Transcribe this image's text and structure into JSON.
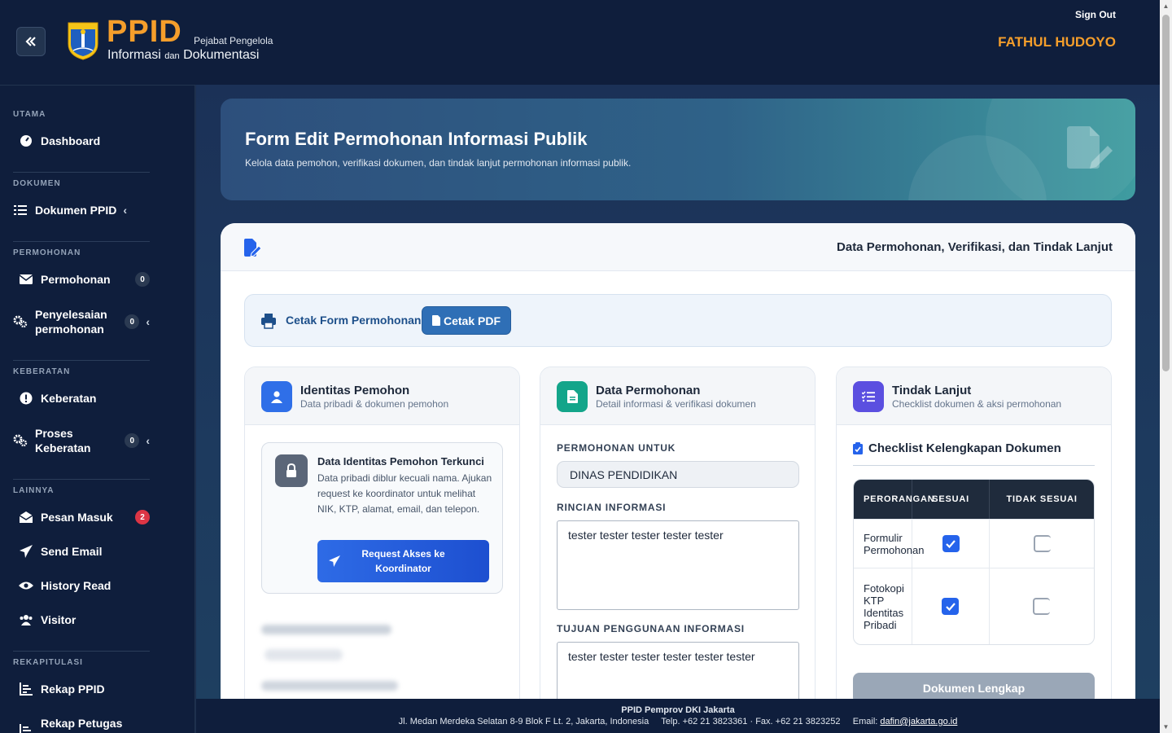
{
  "header": {
    "logo_main": "PPID",
    "logo_line1": "Pejabat Pengelola",
    "logo_line2a": "Informasi",
    "logo_line2b": "dan",
    "logo_line2c": "Dokumentasi",
    "signout": "Sign Out",
    "username": "FATHUL HUDOYO"
  },
  "sidebar": {
    "sections": {
      "utama": "UTAMA",
      "dokumen": "DOKUMEN",
      "permohonan": "PERMOHONAN",
      "keberatan": "KEBERATAN",
      "lainnya": "LAINNYA",
      "rekapitulasi": "REKAPITULASI"
    },
    "items": {
      "dashboard": "Dashboard",
      "dokumen_ppid": "Dokumen PPID",
      "permohonan": "Permohonan",
      "permohonan_count": "0",
      "penyelesaian_1": "Penyelesaian",
      "penyelesaian_2": "permohonan",
      "penyelesaian_count": "0",
      "keberatan": "Keberatan",
      "proses_1": "Proses",
      "proses_2": "Keberatan",
      "proses_count": "0",
      "pesan_masuk": "Pesan Masuk",
      "pesan_count": "2",
      "send_email": "Send Email",
      "history_read": "History Read",
      "visitor": "Visitor",
      "rekap_ppid": "Rekap PPID",
      "rekap_petugas": "Rekap Petugas Data"
    }
  },
  "hero": {
    "title": "Form Edit Permohonan Informasi Publik",
    "subtitle": "Kelola data pemohon, verifikasi dokumen, dan tindak lanjut permohonan informasi publik."
  },
  "card": {
    "title": "Data Permohonan, Verifikasi, dan Tindak Lanjut",
    "print_label": "Cetak Form Permohonan",
    "pdf_label": "Cetak PDF"
  },
  "identitas": {
    "title": "Identitas Pemohon",
    "subtitle": "Data pribadi & dokumen pemohon",
    "lock_title": "Data Identitas Pemohon Terkunci",
    "lock_desc": "Data pribadi diblur kecuali nama. Ajukan request ke koordinator untuk melihat NIK, KTP, alamat, email, dan telepon.",
    "request_button": "Request Akses ke Koordinator"
  },
  "data_permohonan": {
    "title": "Data Permohonan",
    "subtitle": "Detail informasi & verifikasi dokumen",
    "untuk_label": "PERMOHONAN UNTUK",
    "untuk_value": "DINAS PENDIDIKAN",
    "rincian_label": "RINCIAN INFORMASI",
    "rincian_value": "tester tester tester tester tester",
    "tujuan_label": "TUJUAN PENGGUNAAN INFORMASI",
    "tujuan_value": "tester tester tester tester tester tester"
  },
  "tindak_lanjut": {
    "title": "Tindak Lanjut",
    "subtitle": "Checklist dokumen & aksi permohonan",
    "checklist_title": "Checklist Kelengkapan Dokumen",
    "col_perorangan": "PERORANGAN",
    "col_sesuai": "SESUAI",
    "col_tidak": "TIDAK SESUAI",
    "rows": [
      {
        "label": "Formulir Permohonan",
        "sesuai": true,
        "tidak_sesuai": false
      },
      {
        "label": "Fotokopi KTP Identitas Pribadi",
        "sesuai": true,
        "tidak_sesuai": false
      }
    ],
    "lengkap_button": "Dokumen Lengkap"
  },
  "footer": {
    "org": "PPID Pemprov DKI Jakarta",
    "address": "Jl. Medan Merdeka Selatan 8-9 Blok F Lt. 2, Jakarta, Indonesia",
    "phone": "Telp. +62 21 3823361 · Fax. +62 21 3823252",
    "email_label": "Email:",
    "email": "dafin@jakarta.go.id"
  },
  "colors": {
    "accent_orange": "#f59e2b",
    "primary_blue": "#2563eb",
    "navy": "#0f1e3c"
  }
}
